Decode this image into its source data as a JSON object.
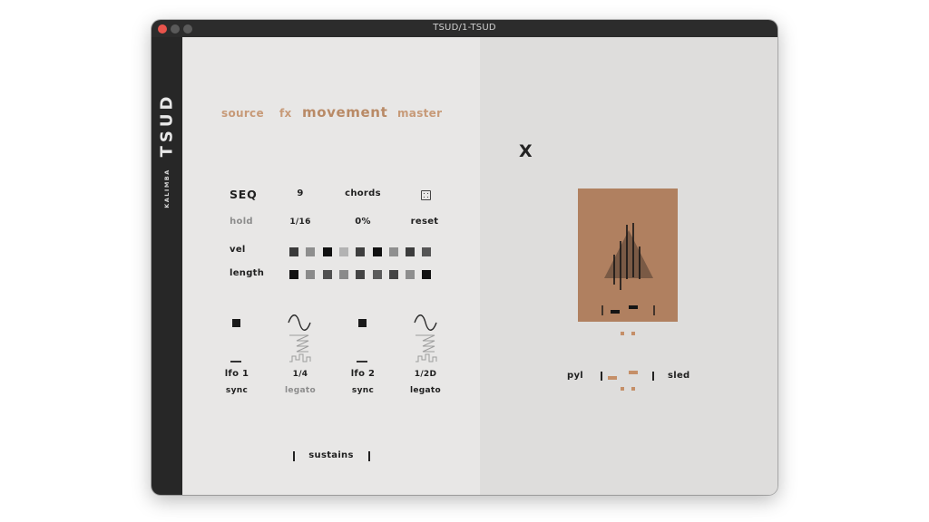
{
  "window": {
    "title": "TSUD/1-TSUD"
  },
  "sidebar": {
    "brand": "TSUD",
    "instrument": "KALIMBA"
  },
  "tabs": [
    {
      "label": "source",
      "active": false
    },
    {
      "label": "fx",
      "active": false
    },
    {
      "label": "movement",
      "active": true
    },
    {
      "label": "master",
      "active": false
    }
  ],
  "seq": {
    "title": "SEQ",
    "steps": "9",
    "chords_label": "chords",
    "dice_icon": "dice-icon",
    "hold_label": "hold",
    "rate": "1/16",
    "swing": "0%",
    "reset_label": "reset",
    "vel_label": "vel",
    "length_label": "length",
    "vel_steps": [
      "#3a3a3a",
      "#8e8e8e",
      "#111111",
      "#b3b3b3",
      "#3e3e3e",
      "#111111",
      "#8f8f8f",
      "#3c3c3c",
      "#555555"
    ],
    "length_steps": [
      "#111111",
      "#8a8a8a",
      "#505050",
      "#8a8a8a",
      "#444444",
      "#5b5b5b",
      "#444444",
      "#8e8e8e",
      "#111111"
    ]
  },
  "lfos": [
    {
      "name": "lfo 1",
      "mode": "sync",
      "mode_active": true
    },
    {
      "name": "1/4",
      "mode": "legato",
      "mode_active": false
    },
    {
      "name": "lfo 2",
      "mode": "sync",
      "mode_active": true
    },
    {
      "name": "1/2D",
      "mode": "legato",
      "mode_active": true
    }
  ],
  "sustains": {
    "label": "sustains"
  },
  "right": {
    "close_label": "X",
    "pyl_label": "pyl",
    "sled_label": "sled",
    "accent_color": "#b08060"
  }
}
